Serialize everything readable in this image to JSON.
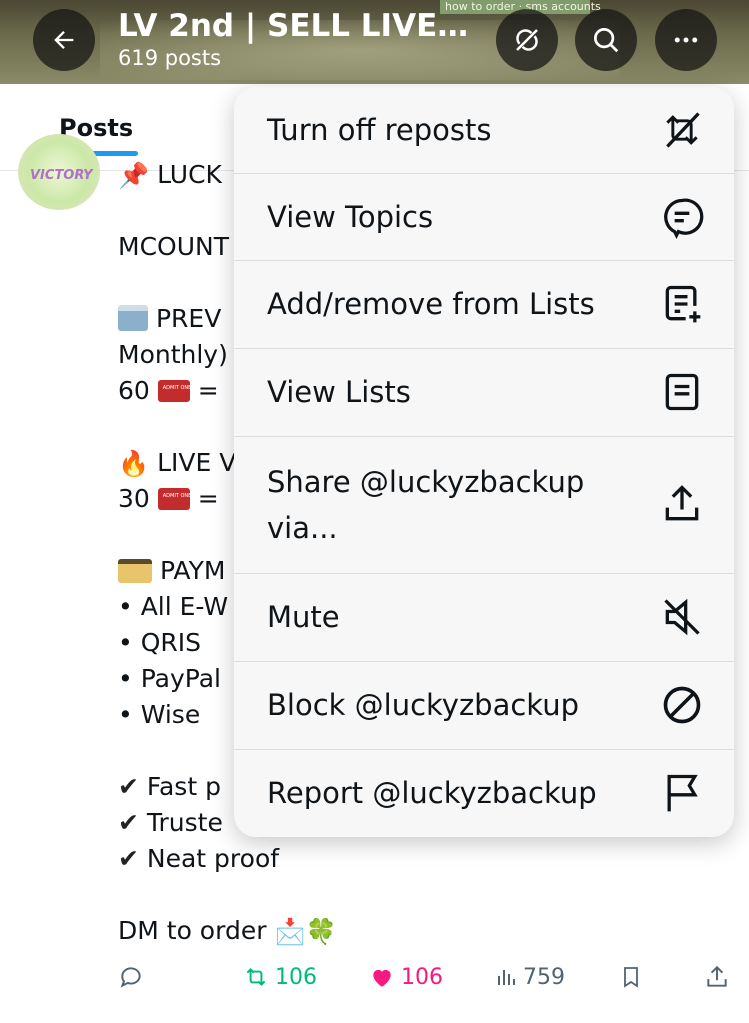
{
  "header": {
    "title": "LV 2nd | SELL LIVE…",
    "subtitle": "619 posts",
    "banner_text": "how to order · sms accounts"
  },
  "tabs": {
    "active": "Posts"
  },
  "avatar": {
    "text": "VICTORY"
  },
  "post": {
    "line1_prefix": "📌",
    "line1": "LUCK",
    "line2": "MCOUNT",
    "line3": "PREV",
    "line4": "Monthly)",
    "line5_num": "60",
    "line5_rest": "= ",
    "line6_prefix": "🔥",
    "line6": "LIVE V",
    "line7_num": "30",
    "line7_rest": "= ",
    "line8": "PAYM",
    "bullet1": "• All E-W",
    "bullet2": "• QRIS",
    "bullet3": "• PayPal",
    "bullet4": "• Wise",
    "check_mark": "✔",
    "check1": "Fast p",
    "check2": "Truste",
    "check3": "Neat proof",
    "dm_text": "DM to order",
    "dm_emoji1": "📩",
    "dm_emoji2": "🍀"
  },
  "actions": {
    "reposts": "106",
    "likes": "106",
    "views": "759"
  },
  "menu": {
    "items": [
      {
        "label": "Turn off reposts",
        "icon": "repost-off-icon"
      },
      {
        "label": "View Topics",
        "icon": "topics-icon"
      },
      {
        "label": "Add/remove from Lists",
        "icon": "list-add-icon"
      },
      {
        "label": "View Lists",
        "icon": "list-icon"
      },
      {
        "label": "Share @luckyzbackup",
        "label2": "via...",
        "icon": "share-icon"
      },
      {
        "label": "Mute",
        "icon": "mute-icon"
      },
      {
        "label": "Block @luckyzbackup",
        "icon": "block-icon"
      },
      {
        "label": "Report @luckyzbackup",
        "icon": "flag-icon"
      }
    ]
  },
  "colors": {
    "accent": "#1d9bf0",
    "like": "#f91880",
    "repost": "#00ba7c"
  }
}
